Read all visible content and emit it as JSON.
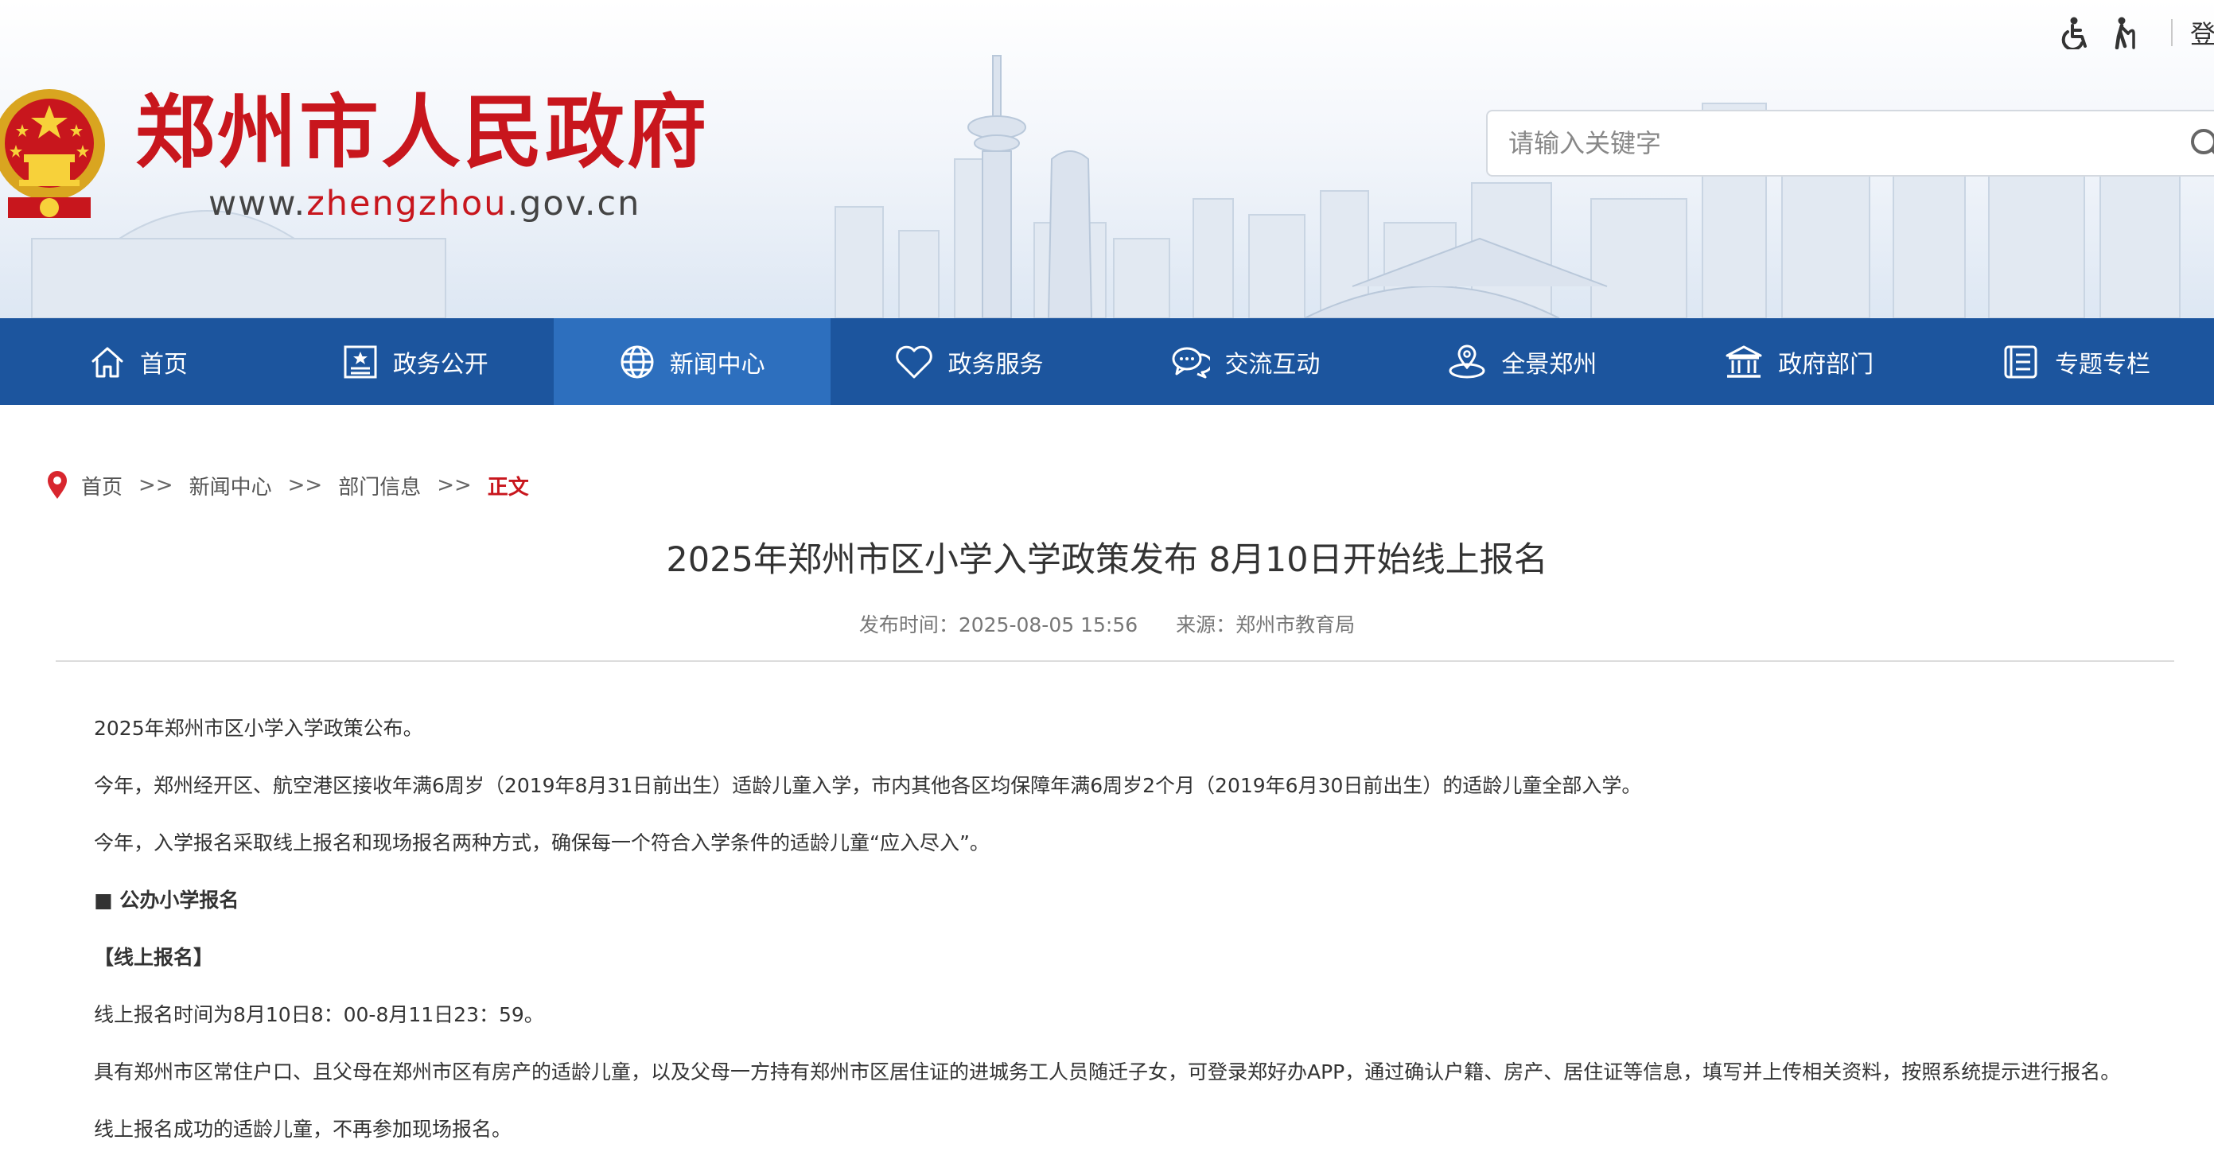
{
  "header": {
    "site_title": "郑州市人民政府",
    "site_url_prefix": "www.",
    "site_url_accent": "zhengzhou",
    "site_url_suffix": ".gov.cn",
    "login_label": "登录",
    "tools": [
      "accessibility-icon",
      "elderly-mode-icon"
    ]
  },
  "search": {
    "placeholder": "请输入关键字"
  },
  "nav": {
    "items": [
      {
        "label": "首页",
        "icon": "home-icon"
      },
      {
        "label": "政务公开",
        "icon": "public-info-icon"
      },
      {
        "label": "新闻中心",
        "icon": "globe-icon",
        "active": true
      },
      {
        "label": "政务服务",
        "icon": "heart-icon"
      },
      {
        "label": "交流互动",
        "icon": "chat-icon"
      },
      {
        "label": "全景郑州",
        "icon": "panorama-icon"
      },
      {
        "label": "政府部门",
        "icon": "government-building-icon"
      },
      {
        "label": "专题专栏",
        "icon": "topic-icon"
      }
    ]
  },
  "breadcrumb": {
    "items": [
      "首页",
      "新闻中心",
      "部门信息"
    ],
    "separator": ">>",
    "current": "正文"
  },
  "article": {
    "title": "2025年郑州市区小学入学政策发布 8月10日开始线上报名",
    "publish_time": "发布时间：2025-08-05 15:56",
    "source": "来源：郑州市教育局",
    "paragraphs": [
      "2025年郑州市区小学入学政策公布。",
      "今年，郑州经开区、航空港区接收年满6周岁（2019年8月31日前出生）适龄儿童入学，市内其他各区均保障年满6周岁2个月（2019年6月30日前出生）的适龄儿童全部入学。",
      "今年，入学报名采取线上报名和现场报名两种方式，确保每一个符合入学条件的适龄儿童“应入尽入”。",
      "■ 公办小学报名",
      "【线上报名】",
      "线上报名时间为8月10日8：00-8月11日23：59。",
      "具有郑州市区常住户口、且父母在郑州市区有房产的适龄儿童，以及父母一方持有郑州市区居住证的进城务工人员随迁子女，可登录郑好办APP，通过确认户籍、房产、居住证等信息，填写并上传相关资料，按照系统提示进行报名。",
      "线上报名成功的适龄儿童，不再参加现场报名。"
    ]
  },
  "colors": {
    "brand_red": "#c8161d",
    "nav_blue": "#1c559e",
    "nav_active": "#2d6fbe"
  }
}
